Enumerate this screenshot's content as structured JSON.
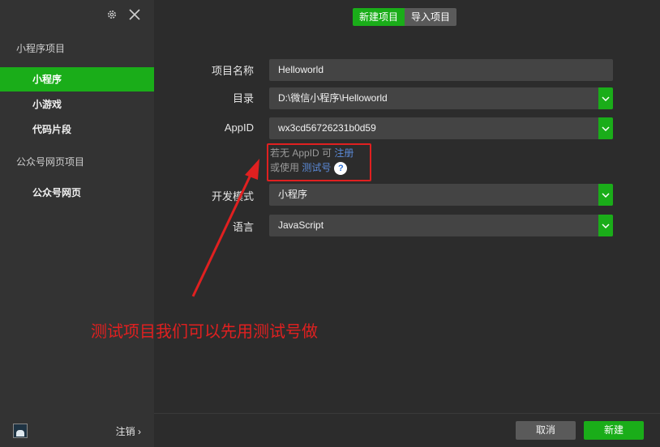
{
  "sidebar": {
    "groups": [
      {
        "label": "小程序项目",
        "items": [
          "小程序",
          "小游戏",
          "代码片段"
        ]
      },
      {
        "label": "公众号网页项目",
        "items": [
          "公众号网页"
        ]
      }
    ],
    "active_item": "小程序",
    "logout_label": "注销 ›"
  },
  "tabs": [
    "新建项目",
    "导入项目"
  ],
  "form": {
    "name": {
      "label": "项目名称",
      "value": "Helloworld"
    },
    "dir": {
      "label": "目录",
      "value": "D:\\微信小程序\\Helloworld"
    },
    "appid": {
      "label": "AppID",
      "value": "wx3cd56726231b0d59"
    },
    "hint_line1_prefix": "若无 AppID 可 ",
    "hint_register": "注册",
    "hint_line2_prefix": "或使用 ",
    "hint_test": "测试号",
    "help_glyph": "?",
    "mode": {
      "label": "开发模式",
      "value": "小程序"
    },
    "lang": {
      "label": "语言",
      "value": "JavaScript"
    }
  },
  "annotation": "测试项目我们可以先用测试号做",
  "buttons": {
    "cancel": "取消",
    "create": "新建"
  },
  "colors": {
    "accent": "#1aad19",
    "annotation": "#e02020",
    "link": "#5b8ad8"
  },
  "icons": {
    "settings": "gear-icon",
    "close": "close-icon",
    "dropdown": "chevron-down-icon",
    "help": "question-circle-icon"
  }
}
